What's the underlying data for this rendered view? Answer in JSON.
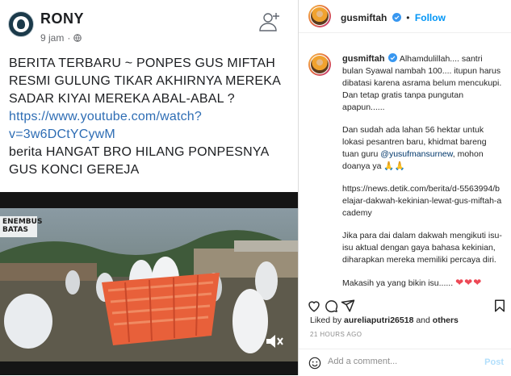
{
  "facebook": {
    "author": "RONY",
    "meta_time": "9 jam",
    "meta_sep": "·",
    "post_line1": "BERITA TERBARU ~ PONPES GUS MIFTAH RESMI GULUNG TIKAR AKHIRNYA MEREKA SADAR KIYAI MEREKA ABAL-ABAL ?",
    "post_link": "https://www.youtube.com/watch?v=3w6DCtYCywM",
    "post_line2": "berita HANGAT BRO HILANG PONPESNYA GUS KONCI GEREJA",
    "video_logo_top": "ENEMBUS",
    "video_logo_bottom": "BATAS"
  },
  "instagram": {
    "username": "gusmiftah",
    "dot": "•",
    "follow_label": "Follow",
    "caption_user": "gusmiftah",
    "caption_p1": "Alhamdulillah.... santri bulan Syawal nambah 100.... itupun harus dibatasi karena asrama belum mencukupi. Dan tetap gratis tanpa pungutan apapun......",
    "caption_p2_before": "Dan sudah ada lahan 56 hektar untuk lokasi pesantren baru, khidmat bareng tuan guru ",
    "caption_p2_mention": "@yusufmansurnew",
    "caption_p2_after": ", mohon doanya ya 🙏🙏",
    "caption_p3": "https://news.detik.com/berita/d-5563994/belajar-dakwah-kekinian-lewat-gus-miftah-academy",
    "caption_p4": "Jika para dai dalam dakwah mengikuti isu-isu aktual dengan gaya bahasa kekinian, diharapkan mereka memiliki percaya diri.",
    "caption_p5": "Makasih ya yang bikin isu......",
    "caption_hearts": "❤❤❤",
    "liked_prefix": "Liked by ",
    "liked_user": "aureliaputri26518",
    "liked_mid": " and ",
    "liked_others": "others",
    "timestamp": "21 HOURS AGO",
    "comment_placeholder": "Add a comment...",
    "post_label": "Post",
    "colors": {
      "accent": "#0095f6",
      "post_disabled": "#b2dffc",
      "like_red": "#ed4956"
    },
    "icons": [
      "heart-icon",
      "comment-icon",
      "share-icon",
      "bookmark-icon",
      "smiley-icon",
      "verified-badge-icon"
    ]
  }
}
